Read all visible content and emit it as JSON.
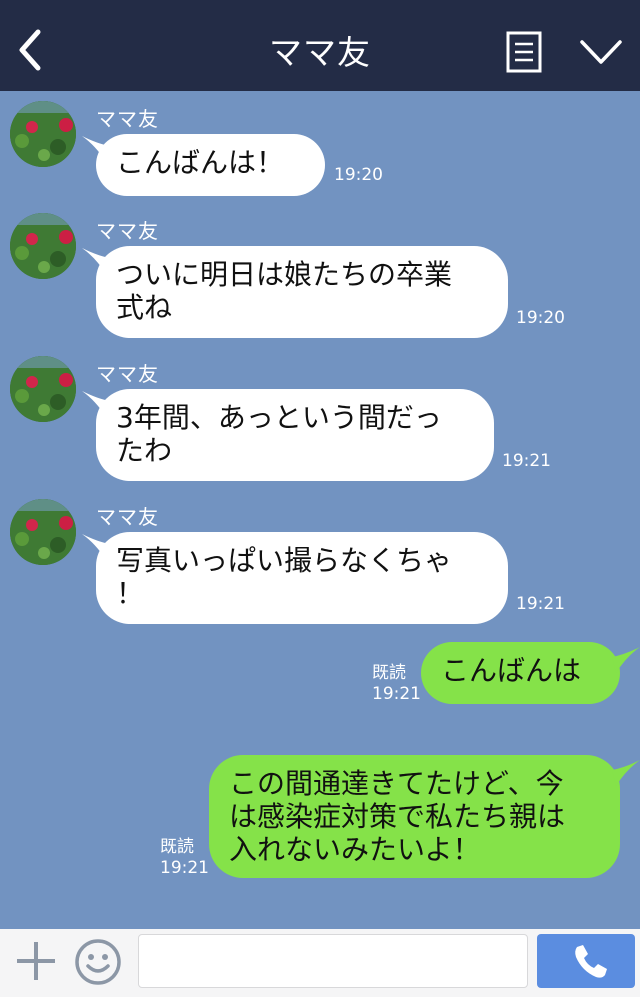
{
  "header": {
    "title": "ママ友"
  },
  "messages": [
    {
      "sender": "ママ友",
      "lines": [
        "こんばんは！"
      ],
      "time": "19:20"
    },
    {
      "sender": "ママ友",
      "lines": [
        "ついに明日は娘たちの卒業",
        "式ね"
      ],
      "time": "19:20"
    },
    {
      "sender": "ママ友",
      "lines": [
        "3年間、あっという間だっ",
        "たわ"
      ],
      "time": "19:21"
    },
    {
      "sender": "ママ友",
      "lines": [
        "写真いっぱい撮らなくちゃ",
        "！"
      ],
      "time": "19:21"
    }
  ],
  "sent": [
    {
      "lines": [
        "こんばんは"
      ],
      "read": "既読",
      "time": "19:21"
    },
    {
      "lines": [
        "この間通達きてたけど、今",
        "は感染症対策で私たち親は",
        "入れないみたいよ！"
      ],
      "read": "既読",
      "time": "19:21"
    }
  ],
  "icons": {
    "back": "chevron-left-icon",
    "notes": "notes-icon",
    "menu": "chevron-down-icon",
    "add": "plus-icon",
    "emoji": "smiley-icon",
    "call": "phone-icon"
  },
  "colors": {
    "header_bg": "#232c46",
    "chat_bg": "#7293c1",
    "incoming_bubble": "#ffffff",
    "outgoing_bubble": "#85e249",
    "call_button": "#5b8de0"
  }
}
